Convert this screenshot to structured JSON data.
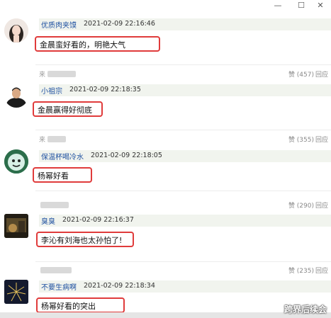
{
  "window": {
    "minimize": "—",
    "maximize": "☐",
    "close": "✕"
  },
  "comments": [
    {
      "user": "优质肉夹馍",
      "time": "2021-02-09 22:16:46",
      "text": "金晨蛮好看的，明艳大气"
    },
    {
      "parent": "来",
      "likes": "赞 (457)",
      "reply": "回应",
      "user": "小祖宗",
      "time": "2021-02-09 22:18:35",
      "text": "金晨赢得好彻底"
    },
    {
      "parent": "来",
      "likes": "赞 (355)",
      "reply": "回应",
      "user": "保温杯喝冷水",
      "time": "2021-02-09 22:18:05",
      "text": "杨幂好看"
    },
    {
      "parent": "",
      "likes": "赞 (290)",
      "reply": "回应",
      "user": "臭臭",
      "time": "2021-02-09 22:16:37",
      "text": "李沁有刘海也太孙怕了!"
    },
    {
      "parent": "",
      "likes": "赞 (235)",
      "reply": "回应",
      "user": "不要生病啊",
      "time": "2021-02-09 22:18:34",
      "text": "杨幂好看的突出"
    }
  ],
  "watermark": "跨界后续会"
}
